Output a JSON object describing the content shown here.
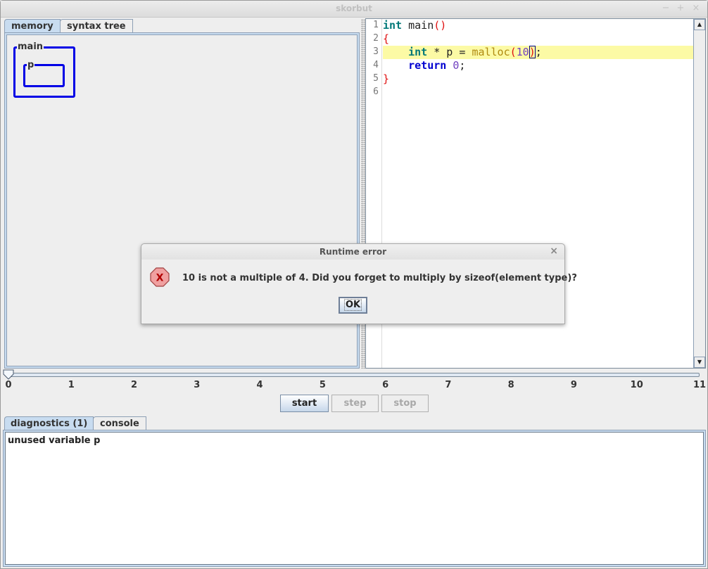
{
  "window": {
    "title": "skorbut",
    "controls": {
      "minimize": "−",
      "maximize": "+",
      "close": "×"
    }
  },
  "left_tabs": [
    {
      "label": "memory",
      "active": true
    },
    {
      "label": "syntax tree",
      "active": false
    }
  ],
  "memory": {
    "frames": [
      {
        "name": "main",
        "variables": [
          {
            "name": "p"
          }
        ]
      }
    ],
    "box_color": "#0000e6"
  },
  "editor": {
    "line_numbers": [
      "1",
      "2",
      "3",
      "4",
      "5",
      "6"
    ],
    "highlighted_line": 3,
    "lines": [
      {
        "tokens": [
          {
            "t": "int",
            "c": "kw-type"
          },
          {
            "t": " main",
            "c": ""
          },
          {
            "t": "()",
            "c": "paren"
          }
        ]
      },
      {
        "tokens": [
          {
            "t": "{",
            "c": "paren"
          }
        ]
      },
      {
        "tokens": [
          {
            "t": "    ",
            "c": ""
          },
          {
            "t": "int",
            "c": "kw-type"
          },
          {
            "t": " * p = ",
            "c": ""
          },
          {
            "t": "malloc",
            "c": "fn"
          },
          {
            "t": "(",
            "c": "paren"
          },
          {
            "t": "10",
            "c": "num"
          },
          {
            "t": ")",
            "c": "paren cursor-box"
          },
          {
            "t": ";",
            "c": ""
          }
        ]
      },
      {
        "tokens": [
          {
            "t": "    ",
            "c": ""
          },
          {
            "t": "return",
            "c": "kw"
          },
          {
            "t": " ",
            "c": ""
          },
          {
            "t": "0",
            "c": "num"
          },
          {
            "t": ";",
            "c": ""
          }
        ]
      },
      {
        "tokens": [
          {
            "t": "}",
            "c": "paren"
          }
        ]
      },
      {
        "tokens": []
      }
    ],
    "scroll_up_icon": "▲",
    "scroll_down_icon": "▼"
  },
  "timeline": {
    "min": 0,
    "max": 11,
    "value": 0,
    "ticks": [
      "0",
      "1",
      "2",
      "3",
      "4",
      "5",
      "6",
      "7",
      "8",
      "9",
      "10",
      "11"
    ]
  },
  "controls": {
    "start": {
      "label": "start",
      "enabled": true
    },
    "step": {
      "label": "step",
      "enabled": false
    },
    "stop": {
      "label": "stop",
      "enabled": false
    }
  },
  "bottom_tabs": [
    {
      "label": "diagnostics (1)",
      "active": true
    },
    {
      "label": "console",
      "active": false
    }
  ],
  "diagnostics": {
    "messages": [
      "unused variable p"
    ]
  },
  "dialog": {
    "title": "Runtime error",
    "close_icon": "×",
    "icon": "error-icon",
    "icon_glyph": "X",
    "message": "10 is not a multiple of 4. Did you forget to multiply by sizeof(element type)?",
    "ok_label": "OK"
  },
  "colors": {
    "accent": "#c8dcf0",
    "highlight_line": "#fcfaa5",
    "error_icon_fill": "#f0a0a0",
    "error_icon_glyph": "#b00000"
  }
}
